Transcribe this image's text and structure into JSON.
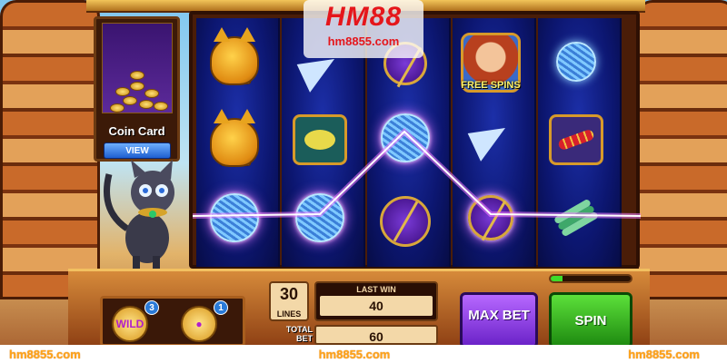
{
  "watermark": {
    "brand": "HM88",
    "url": "hm8855.com"
  },
  "coin_card": {
    "title": "Coin Card",
    "view_label": "VIEW"
  },
  "reels": [
    [
      "wild-cat",
      "paper-plane",
      "scarab"
    ],
    [
      "wild-cat",
      "mouse-tile",
      "yarn-ball"
    ],
    [
      "yarn-ball",
      "yarn-ball",
      "golden-sphere"
    ],
    [
      "scarab",
      "yarn-ball",
      "yarn-ball"
    ],
    [
      "free-spins-girl",
      "paper-plane",
      "scarab"
    ],
    [
      "yarn-ball",
      "snake-tile",
      "dragonfly"
    ]
  ],
  "symbols": {
    "wild_label": "WILD",
    "free_spins_label": "FREE SPINS"
  },
  "boosts": [
    {
      "label": "WILD",
      "count": "3"
    },
    {
      "label": "",
      "count": "1"
    }
  ],
  "controls": {
    "lines_value": "30",
    "lines_label": "LINES",
    "last_win_label": "LAST WIN",
    "last_win_value": "40",
    "total_bet_label": "TOTAL BET",
    "total_bet_value": "60",
    "max_bet_label": "MAX BET",
    "spin_label": "SPIN",
    "progress": 0.15
  },
  "footer": [
    "hm8855.com",
    "hm8855.com",
    "hm8855.com"
  ],
  "colors": {
    "payline": "#f27bff",
    "spin": "#3edc2a",
    "max_bet": "#8a3cf0",
    "logo": "#e5161b"
  }
}
